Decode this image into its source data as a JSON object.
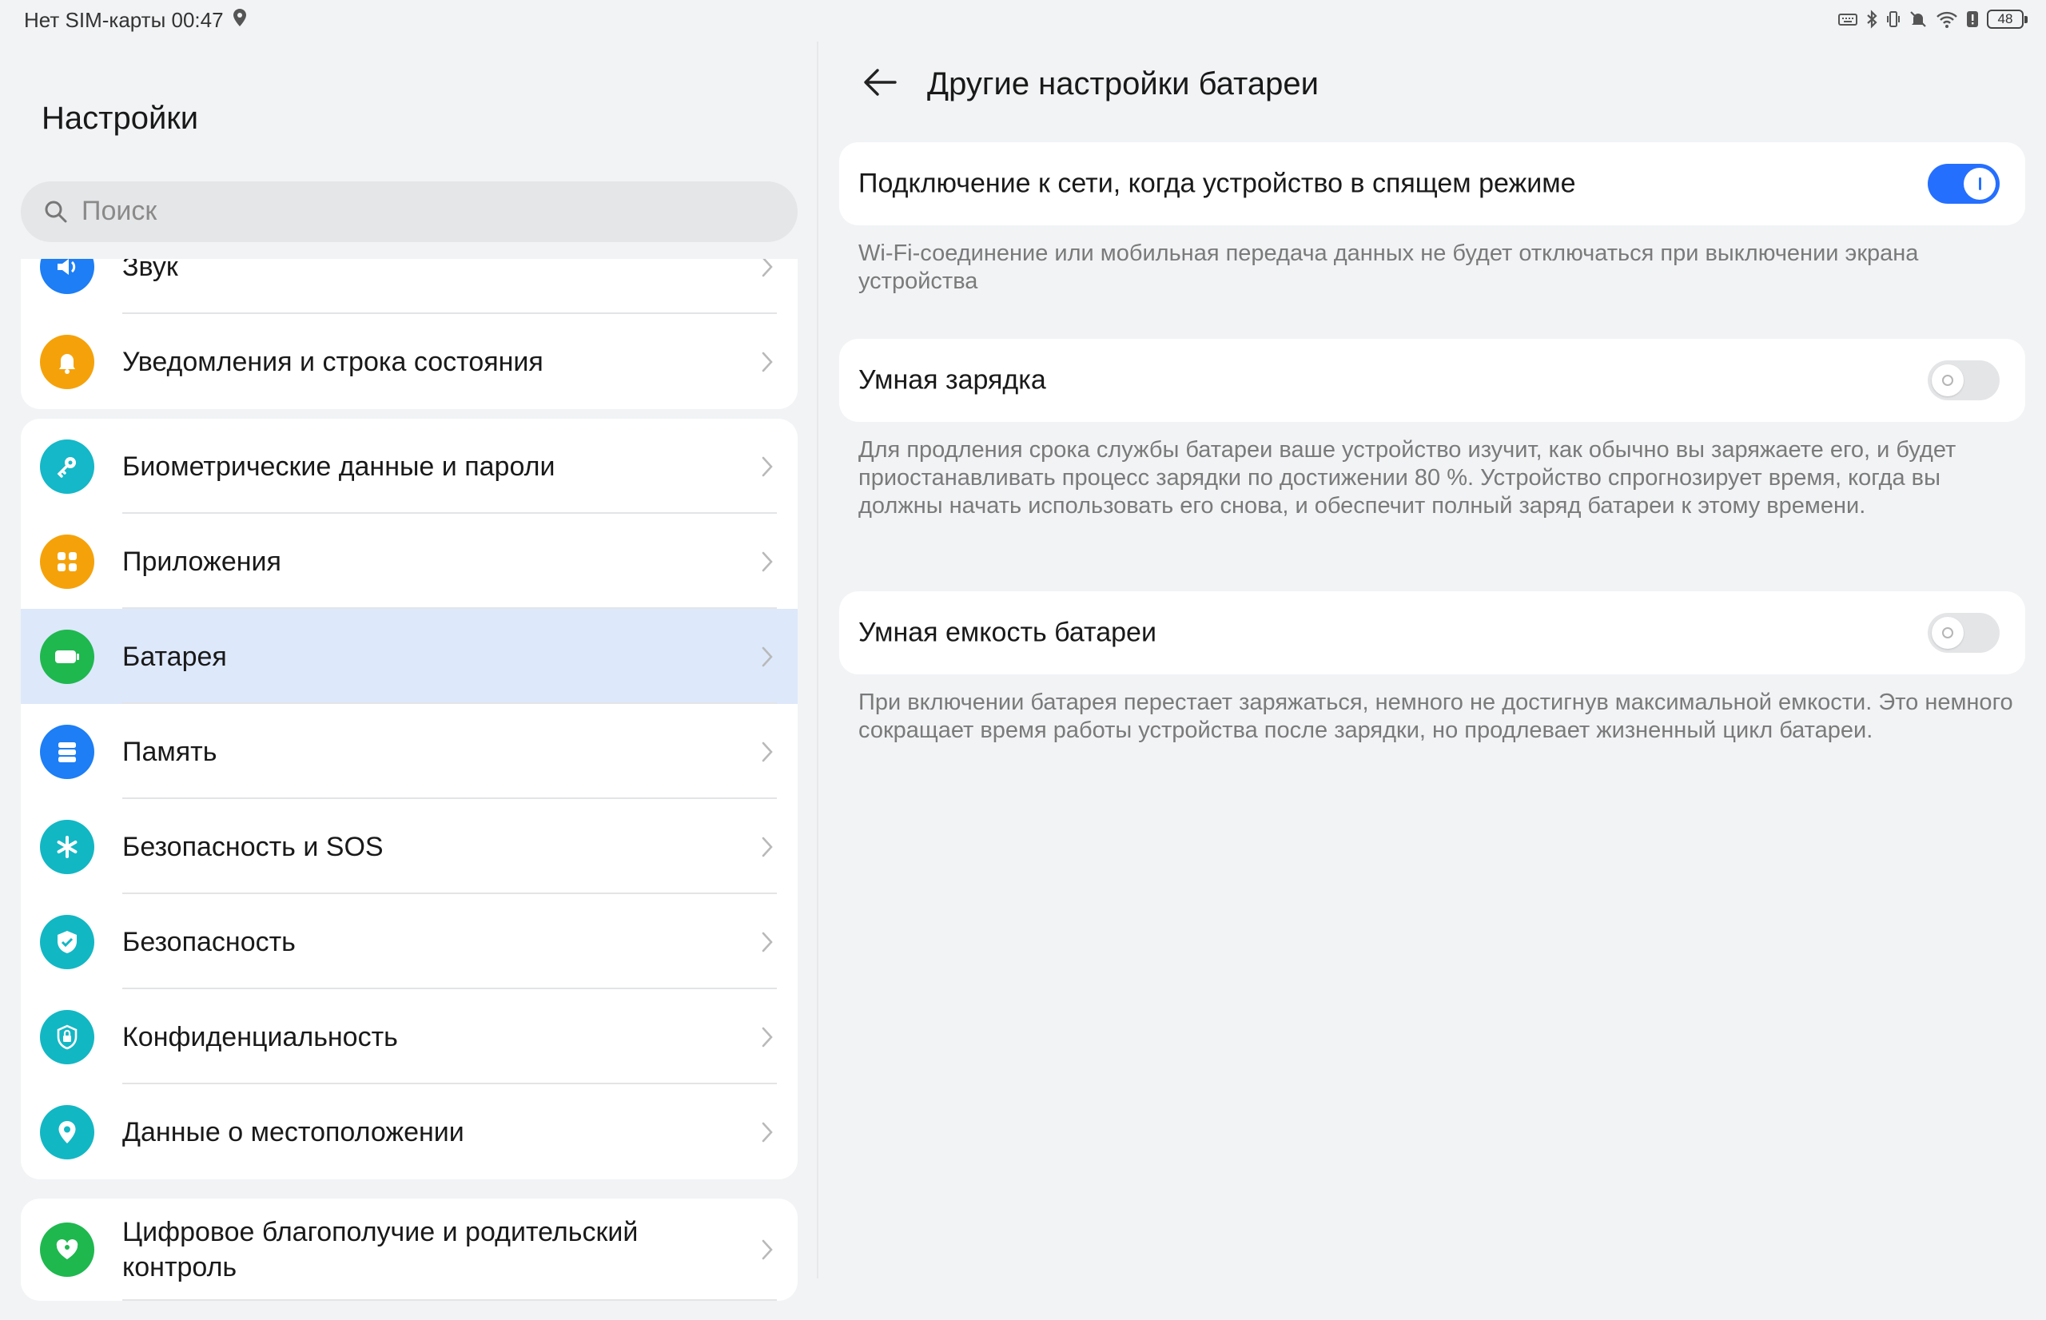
{
  "status_bar": {
    "left_text": "Нет SIM-карты 00:47",
    "battery_level": "48",
    "icons": [
      "location-icon",
      "keyboard-icon",
      "bluetooth-icon",
      "vibrate-icon",
      "mute-icon",
      "wifi-icon",
      "alert-icon",
      "battery-icon"
    ]
  },
  "left": {
    "title": "Настройки",
    "search_placeholder": "Поиск",
    "groups": [
      {
        "items": [
          {
            "label": "Звук",
            "icon": "sound-icon",
            "color": "#1d7ef5"
          },
          {
            "label": "Уведомления и строка состояния",
            "icon": "bell-icon",
            "color": "#f5a20a"
          }
        ]
      },
      {
        "items": [
          {
            "label": "Биометрические данные и пароли",
            "icon": "key-icon",
            "color": "#14b8c8"
          },
          {
            "label": "Приложения",
            "icon": "apps-icon",
            "color": "#f5a20a"
          },
          {
            "label": "Батарея",
            "icon": "battery-icon",
            "color": "#1fb84f",
            "selected": true
          },
          {
            "label": "Память",
            "icon": "storage-icon",
            "color": "#1d7ef5"
          },
          {
            "label": "Безопасность и SOS",
            "icon": "asterisk-icon",
            "color": "#12b7c4"
          },
          {
            "label": "Безопасность",
            "icon": "shield-icon",
            "color": "#12b7c4"
          },
          {
            "label": "Конфиденциальность",
            "icon": "privacy-lock-icon",
            "color": "#12b7c4"
          },
          {
            "label": "Данные о местоположении",
            "icon": "location-pin-icon",
            "color": "#12b7c4"
          }
        ]
      },
      {
        "items": [
          {
            "label": "Цифровое благополучие и родительский контроль",
            "icon": "heart-icon",
            "color": "#1fb84f"
          }
        ]
      }
    ]
  },
  "right": {
    "title": "Другие настройки батареи",
    "settings": [
      {
        "label": "Подключение к сети, когда устройство в спящем режиме",
        "enabled": true,
        "description": "Wi-Fi-соединение или мобильная передача данных не будет отключаться при выключении экрана устройства"
      },
      {
        "label": "Умная зарядка",
        "enabled": false,
        "description": "Для продления срока службы батареи ваше устройство изучит, как обычно вы заряжаете его, и будет приостанавливать процесс зарядки по достижении 80 %. Устройство спрогнозирует время, когда вы должны начать использовать его снова, и обеспечит полный заряд батареи к этому времени."
      },
      {
        "label": "Умная емкость батареи",
        "enabled": false,
        "description": "При включении батарея перестает заряжаться, немного не достигнув максимальной емкости. Это немного сокращает время работы устройства после зарядки, но продлевает жизненный цикл батареи."
      }
    ]
  },
  "colors": {
    "accent": "#256fff",
    "selected_row": "#dde8fb",
    "background": "#f1f3f5"
  }
}
